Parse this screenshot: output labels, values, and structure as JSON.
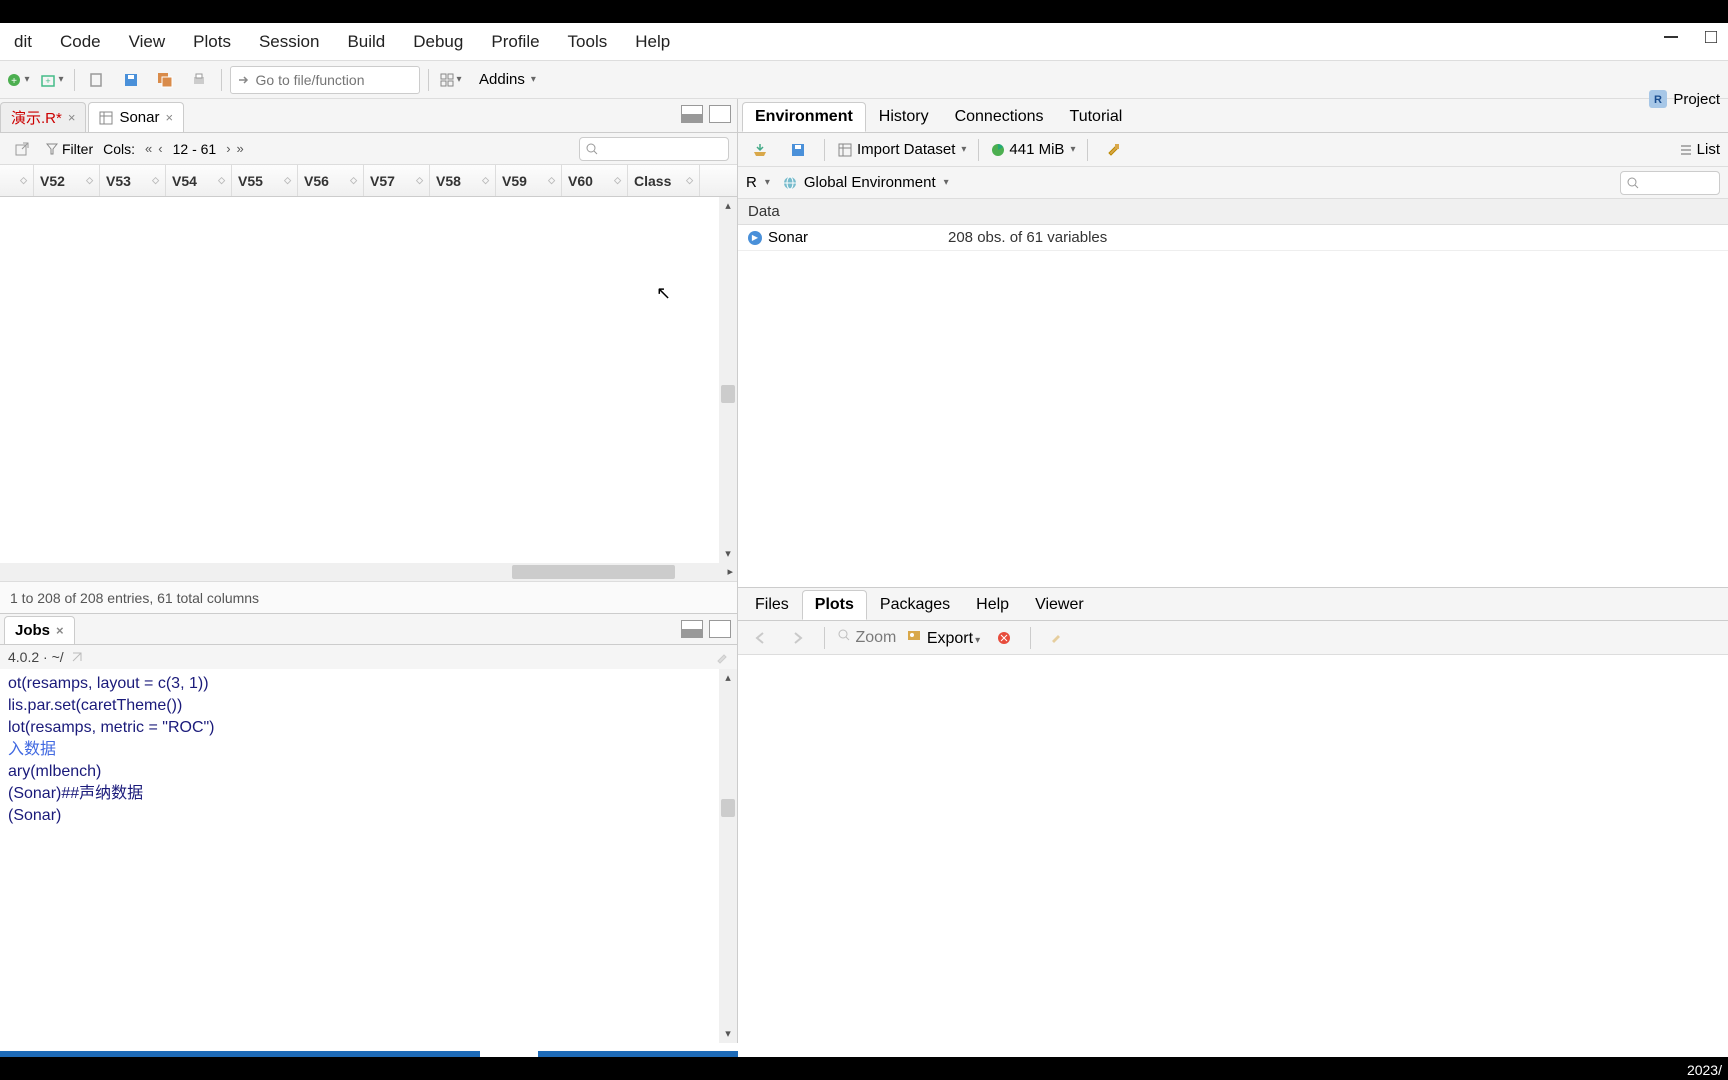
{
  "menu": {
    "items": [
      "dit",
      "Code",
      "View",
      "Plots",
      "Session",
      "Build",
      "Debug",
      "Profile",
      "Tools",
      "Help"
    ]
  },
  "toolbar": {
    "goto_placeholder": "Go to file/function",
    "addins_label": "Addins",
    "project_label": "Project"
  },
  "source_tabs": {
    "tab1": {
      "label": "演示.R*"
    },
    "tab2": {
      "label": "Sonar"
    }
  },
  "data_viewer": {
    "filter_label": "Filter",
    "cols_label": "Cols:",
    "cols_range": "12 - 61",
    "columns": [
      "V52",
      "V53",
      "V54",
      "V55",
      "V56",
      "V57",
      "V58",
      "V59",
      "V60",
      "Class"
    ],
    "status": "1 to 208 of 208 entries, 61 total columns"
  },
  "jobs": {
    "tab_label": "Jobs",
    "info": "4.0.2 · ~/",
    "lines": [
      "ot(resamps, layout = c(3, 1))",
      "lis.par.set(caretTheme())",
      "lot(resamps, metric = \"ROC\")",
      "",
      "入数据",
      "ary(mlbench)",
      "(Sonar)##声纳数据",
      "(Sonar)"
    ]
  },
  "env_pane": {
    "tabs": [
      "Environment",
      "History",
      "Connections",
      "Tutorial"
    ],
    "import_label": "Import Dataset",
    "memory": "441 MiB",
    "list_label": "List",
    "r_label": "R",
    "scope_label": "Global Environment",
    "section": "Data",
    "item_name": "Sonar",
    "item_value": "208 obs. of 61 variables"
  },
  "plots_pane": {
    "tabs": [
      "Files",
      "Plots",
      "Packages",
      "Help",
      "Viewer"
    ],
    "zoom_label": "Zoom",
    "export_label": "Export"
  },
  "footer": {
    "date": "2023/"
  }
}
